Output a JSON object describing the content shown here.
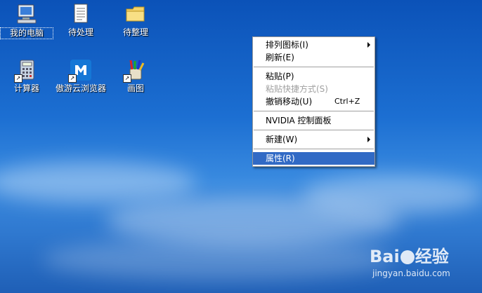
{
  "desktop": {
    "icons": [
      {
        "label": "我的电脑",
        "icon": "my-computer-icon"
      },
      {
        "label": "待处理",
        "icon": "document-icon"
      },
      {
        "label": "待整理",
        "icon": "folder-icon"
      },
      {
        "label": "计算器",
        "icon": "calculator-icon"
      },
      {
        "label": "傲游云浏览器",
        "icon": "maxthon-browser-icon"
      },
      {
        "label": "画图",
        "icon": "paint-icon"
      }
    ]
  },
  "context_menu": {
    "arrange_icons": "排列图标(I)",
    "refresh": "刷新(E)",
    "paste": "粘贴(P)",
    "paste_shortcut": "粘贴快捷方式(S)",
    "undo_move": "撤销移动(U)",
    "undo_shortcut": "Ctrl+Z",
    "nvidia": "NVIDIA 控制面板",
    "new": "新建(W)",
    "properties": "属性(R)"
  },
  "watermark": {
    "logo_left": "Bai",
    "logo_right": "经验",
    "url": "jingyan.baidu.com"
  },
  "colors": {
    "highlight": "#316ac5",
    "desktop_blue": "#1c6fd2"
  }
}
